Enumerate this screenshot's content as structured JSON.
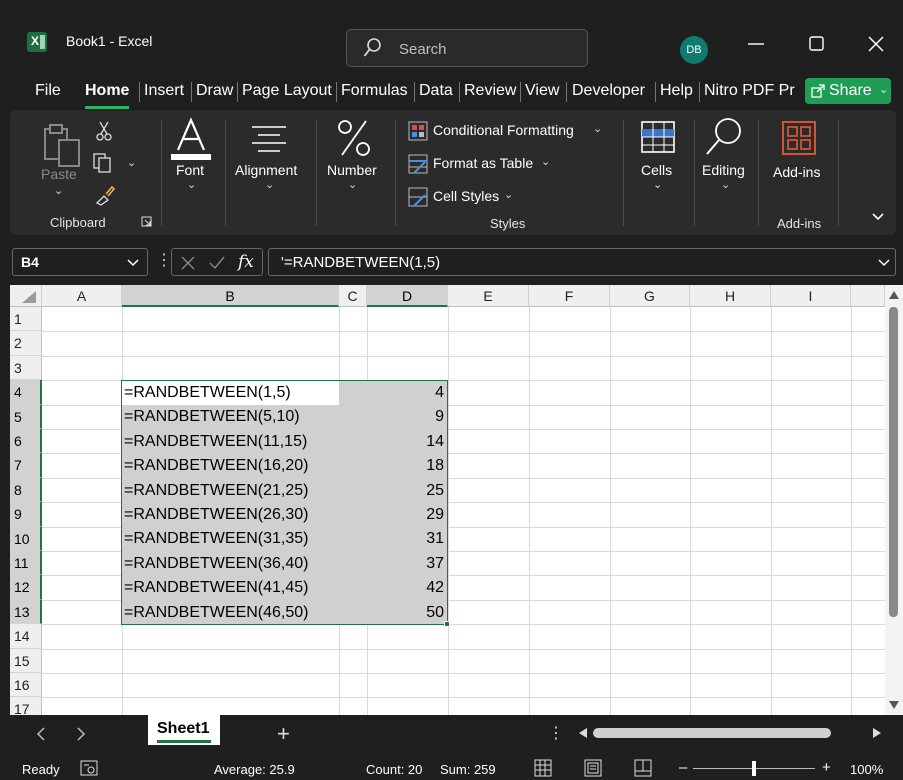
{
  "title_bar": {
    "app_logo": "X",
    "document_title": "Book1  -  Excel",
    "search_placeholder": "Search",
    "user_initials": "DB"
  },
  "menu": {
    "tabs": [
      "File",
      "Home",
      "Insert",
      "Draw",
      "Page Layout",
      "Formulas",
      "Data",
      "Review",
      "View",
      "Developer",
      "Help",
      "Nitro PDF Pr"
    ],
    "active_tab": "Home",
    "share_label": "Share"
  },
  "ribbon": {
    "clipboard": {
      "paste_label": "Paste",
      "group_label": "Clipboard"
    },
    "font_label": "Font",
    "alignment_label": "Alignment",
    "number_label": "Number",
    "styles": {
      "conditional_formatting": "Conditional Formatting",
      "format_as_table": "Format as Table",
      "cell_styles": "Cell Styles",
      "group_label": "Styles"
    },
    "cells_label": "Cells",
    "editing_label": "Editing",
    "addins_label": "Add-ins",
    "addins_group_label": "Add-ins"
  },
  "formula_bar": {
    "name_box": "B4",
    "fx_label": "fx",
    "formula": "'=RANDBETWEEN(1,5)"
  },
  "grid": {
    "columns": [
      "A",
      "B",
      "C",
      "D",
      "E",
      "F",
      "G",
      "H",
      "I"
    ],
    "rows": [
      "1",
      "2",
      "3",
      "4",
      "5",
      "6",
      "7",
      "8",
      "9",
      "10",
      "11",
      "12",
      "13",
      "14",
      "15",
      "16",
      "17"
    ],
    "data": [
      {
        "b": "=RANDBETWEEN(1,5)",
        "d": "4"
      },
      {
        "b": "=RANDBETWEEN(5,10)",
        "d": "9"
      },
      {
        "b": "=RANDBETWEEN(11,15)",
        "d": "14"
      },
      {
        "b": "=RANDBETWEEN(16,20)",
        "d": "18"
      },
      {
        "b": "=RANDBETWEEN(21,25)",
        "d": "25"
      },
      {
        "b": "=RANDBETWEEN(26,30)",
        "d": "29"
      },
      {
        "b": "=RANDBETWEEN(31,35)",
        "d": "31"
      },
      {
        "b": "=RANDBETWEEN(36,40)",
        "d": "37"
      },
      {
        "b": "=RANDBETWEEN(41,45)",
        "d": "42"
      },
      {
        "b": "=RANDBETWEEN(46,50)",
        "d": "50"
      }
    ]
  },
  "sheets": {
    "active": "Sheet1",
    "add_label": "+"
  },
  "status_bar": {
    "ready": "Ready",
    "average": "Average: 25.9",
    "count": "Count: 20",
    "sum": "Sum: 259",
    "zoom": "100%"
  },
  "colors": {
    "accent_green": "#217346",
    "share_green": "#1f9d55",
    "ribbon_bg": "#2b2b2b",
    "titlebar_bg": "#1f1f1f",
    "selection_fill": "#d0d0d0"
  }
}
